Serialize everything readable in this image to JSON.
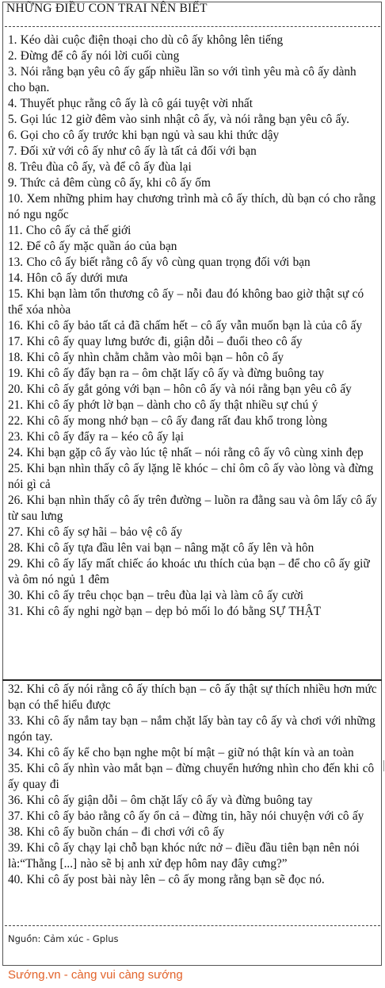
{
  "title": "NHỮNG ĐIỀU CON TRAI NÊN BIẾT",
  "items": [
    "1. Kéo dài cuộc điện thoại cho dù cô ấy không lên tiếng",
    "2. Đừng để cô ấy nói lời cuối cùng",
    "3. Nói rằng bạn yêu cô ấy gấp nhiều lần so với tình yêu mà cô ấy dành cho bạn.",
    "4. Thuyết phục rằng cô ấy là cô gái tuyệt vời nhất",
    "5. Gọi lúc 12 giờ đêm vào sinh nhật cô ấy, và nói rằng bạn yêu cô ấy.",
    "6. Gọi cho cô ấy trước khi bạn ngủ và sau khi thức dậy",
    "7. Đối xử với cô ấy như cô ấy là tất cả đối với bạn",
    "8. Trêu đùa cô ấy, và để cô ấy đùa lại",
    "9. Thức cả đêm cùng cô ấy, khi cô ấy ốm",
    "10. Xem những phim hay chương trình mà cô ấy thích, dù bạn có cho rằng nó ngu ngốc",
    "11. Cho cô ấy cả thế giới",
    "12. Để cô ấy mặc quần áo của bạn",
    "13. Cho cô ấy biết rằng cô ấy vô cùng quan trọng đối với bạn",
    "14. Hôn cô ấy dưới mưa",
    "15. Khi bạn làm tổn thương cô ấy – nỗi đau đó không bao giờ thật sự có thể xóa nhòa",
    "16. Khi cô ấy bảo tất cả đã chấm hết – cô ấy vẫn muốn bạn là của cô ấy",
    "17. Khi cô ấy quay lưng bước đi, giận dỗi – đuổi theo cô ấy",
    "18. Khi cô ấy nhìn chằm chằm vào môi bạn – hôn cô ấy",
    "19. Khi cô ấy đẩy bạn ra – ôm chặt lấy cô ấy và đừng buông tay",
    "20. Khi cô ấy gắt gỏng với bạn – hôn cô ấy và nói rằng bạn yêu cô ấy",
    "21. Khi cô ấy phớt lờ bạn – dành cho cô ấy thật nhiều sự chú ý",
    "22. Khi cô ấy mong nhớ bạn – cô ấy đang rất đau khổ trong lòng",
    "23. Khi cô ấy đẩy ra – kéo cô ấy lại",
    "24. Khi bạn gặp cô ấy vào lúc tệ nhất – nói rằng cô ấy vô cùng xinh đẹp",
    "25. Khi bạn nhìn thấy cô ấy lặng lẽ khóc – chỉ ôm cô ấy vào lòng và đừng nói gì cả",
    "26. Khi bạn nhìn thấy cô ấy trên đường – luồn ra đằng sau và ôm lấy cô ấy từ sau lưng",
    "27. Khi cô ấy sợ hãi – bảo vệ cô ấy",
    "28. Khi cô ấy tựa đầu lên vai bạn – nâng mặt cô ấy lên và hôn",
    "29. Khi cô ấy lấy mất chiếc áo khoác ưu thích của bạn – để cho cô ấy giữ và ôm nó ngủ 1 đêm",
    "30. Khi cô ấy trêu chọc bạn – trêu đùa lại và làm cô ấy cười",
    "31. Khi cô ấy nghi ngờ bạn – dẹp bỏ mối lo đó bằng SỰ THẬT",
    "32. Khi cô ấy nói rằng cô ấy thích bạn – cô ấy thật sự thích nhiều hơn mức bạn có thể hiểu được",
    "33. Khi cô ấy nắm tay bạn – nắm chặt lấy bàn tay cô ấy và chơi với những ngón tay.",
    "34. Khi cô ấy kể cho bạn nghe một bí mật – giữ nó thật kín và an toàn",
    "35. Khi cô ấy nhìn vào mắt bạn – đừng chuyển hướng nhìn cho đến khi cô ấy quay đi",
    "36. Khi cô ấy giận dỗi – ôm chặt lấy cô ấy và đừng buông tay",
    "37. Khi cô ấy bảo rằng cô ấy ổn cả – đừng tin, hãy nói chuyện với cô ấy",
    "38. Khi cô ấy buồn chán – đi chơi với cô ấy",
    "39. Khi cô ấy chạy lại chỗ bạn khóc nức nở – điều đầu tiên bạn nên nói là:“Thằng [...] nào sẽ bị anh xử đẹp hôm nay đây cưng?”",
    "40. Khi cô ấy post bài này lên – cô ấy mong rằng bạn sẽ đọc nó."
  ],
  "source": "Nguồn: Cảm xúc - Gplus",
  "footer": "Sướng.vn - càng vui càng sướng",
  "colors": {
    "footer": "#e2622a",
    "text": "#111111",
    "border": "#555555"
  }
}
